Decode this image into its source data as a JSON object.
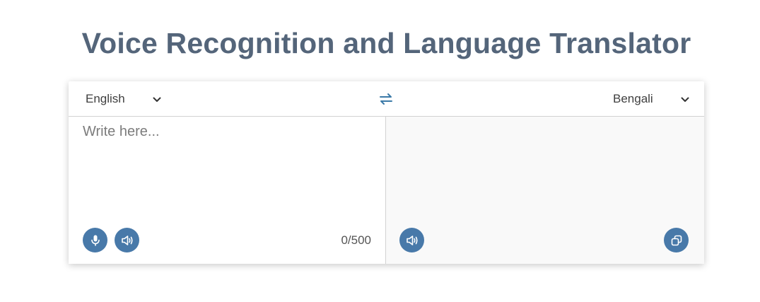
{
  "page": {
    "title": "Voice Recognition and Language Translator"
  },
  "controls": {
    "from_language": "English",
    "to_language": "Bengali"
  },
  "source": {
    "placeholder": "Write here...",
    "value": "",
    "char_count": "0/500"
  },
  "target": {
    "value": ""
  },
  "icons": {
    "swap": "swap-arrows-icon",
    "mic": "microphone-icon",
    "speaker": "speaker-icon",
    "copy": "copy-icon",
    "chevron": "chevron-down-icon"
  },
  "colors": {
    "title": "#54657a",
    "accent": "#4879a9",
    "swap_icon": "#3c7aa8"
  }
}
